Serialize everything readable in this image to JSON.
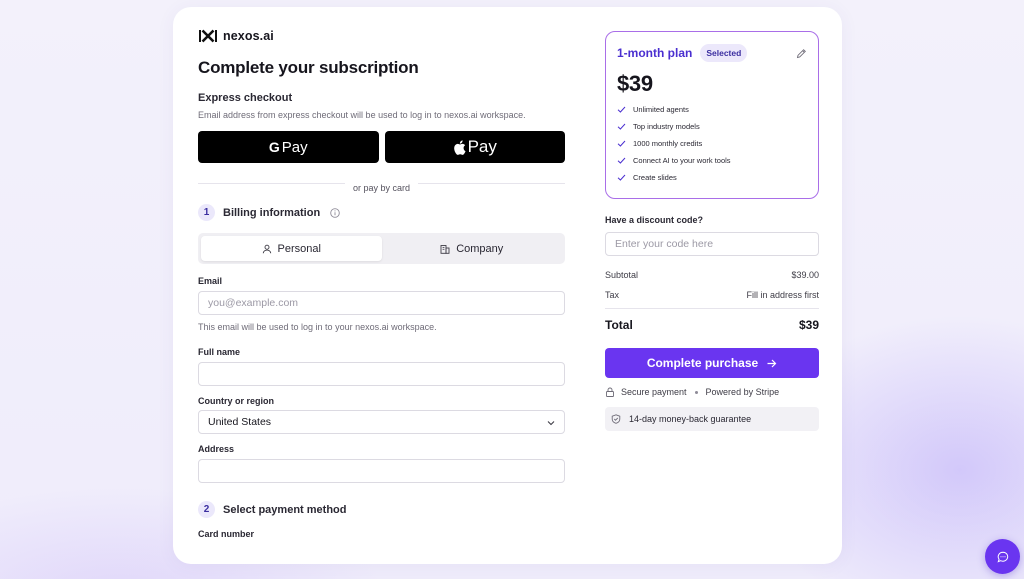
{
  "brand": {
    "name": "nexos.ai"
  },
  "page": {
    "title": "Complete your subscription"
  },
  "express": {
    "title": "Express checkout",
    "note": "Email address from express checkout will be used to log in to nexos.ai workspace.",
    "gpay_label": "Pay",
    "applepay_label": "Pay",
    "divider": "or pay by card"
  },
  "billing": {
    "step": "1",
    "title": "Billing information",
    "tabs": [
      {
        "label": "Personal",
        "icon": "user-icon",
        "active": true
      },
      {
        "label": "Company",
        "icon": "building-icon",
        "active": false
      }
    ],
    "email": {
      "label": "Email",
      "placeholder": "you@example.com",
      "hint": "This email will be used to log in to your nexos.ai workspace."
    },
    "full_name": {
      "label": "Full name",
      "placeholder": ""
    },
    "country": {
      "label": "Country or region",
      "value": "United States"
    },
    "address": {
      "label": "Address",
      "placeholder": ""
    }
  },
  "payment": {
    "step": "2",
    "title": "Select payment method",
    "card_label": "Card number"
  },
  "plan": {
    "name": "1-month plan",
    "badge": "Selected",
    "price": "$39",
    "features": [
      "Unlimited agents",
      "Top industry models",
      "1000 monthly credits",
      "Connect AI to your work tools",
      "Create slides"
    ]
  },
  "discount": {
    "label": "Have a discount code?",
    "placeholder": "Enter your code here"
  },
  "summary": {
    "subtotal_label": "Subtotal",
    "subtotal_value": "$39.00",
    "tax_label": "Tax",
    "tax_value": "Fill in address first",
    "total_label": "Total",
    "total_value": "$39"
  },
  "purchase": {
    "button_label": "Complete purchase",
    "secure": "Secure payment",
    "powered": "Powered by Stripe",
    "guarantee": "14-day money-back guarantee"
  },
  "colors": {
    "accent": "#6a35f0",
    "plan_border": "#a96ee8",
    "plan_title": "#4a2fd0"
  }
}
